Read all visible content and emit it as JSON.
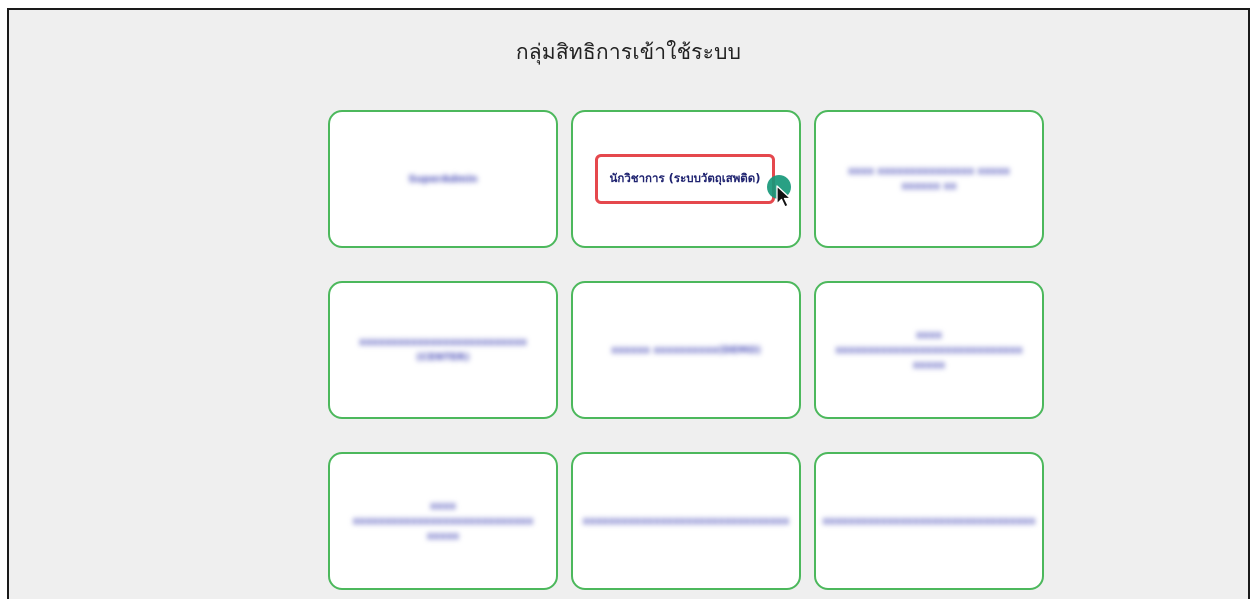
{
  "header": {
    "title": "กลุ่มสิทธิการเข้าใช้ระบบ"
  },
  "roles": [
    {
      "label": "SuperAdmin",
      "obscured": true
    },
    {
      "label": "นักวิชาการ (ระบบวัตถุเสพติด)",
      "obscured": false,
      "highlighted": true
    },
    {
      "label": "xxxx xxxxxxxxxxxxxxx xxxxx xxxxxx xx",
      "obscured": true
    },
    {
      "label": "xxxxxxxxxxxxxxxxxxxxxxxxxx (CENTER)",
      "obscured": true
    },
    {
      "label": "xxxxxx xxxxxxxxxx(DEMO)",
      "obscured": true
    },
    {
      "label": "xxxx xxxxxxxxxxxxxxxxxxxxxxxxxxxxx xxxxx",
      "obscured": true
    },
    {
      "label": "xxxx xxxxxxxxxxxxxxxxxxxxxxxxxxxx xxxxx",
      "obscured": true
    },
    {
      "label": "xxxxxxxxxxxxxxxxxxxxxxxxxxxxxxxx",
      "obscured": true
    },
    {
      "label": "xxxxxxxxxxxxxxxxxxxxxxxxxxxxxxxxx",
      "obscured": true
    }
  ],
  "colors": {
    "card_border": "#4cb85c",
    "highlight": "#e5484d",
    "label_text": "#2c2f8c",
    "cursor": "#17987a",
    "background": "#efefef"
  },
  "icons": {
    "cursor": "mouse-pointer-icon"
  }
}
